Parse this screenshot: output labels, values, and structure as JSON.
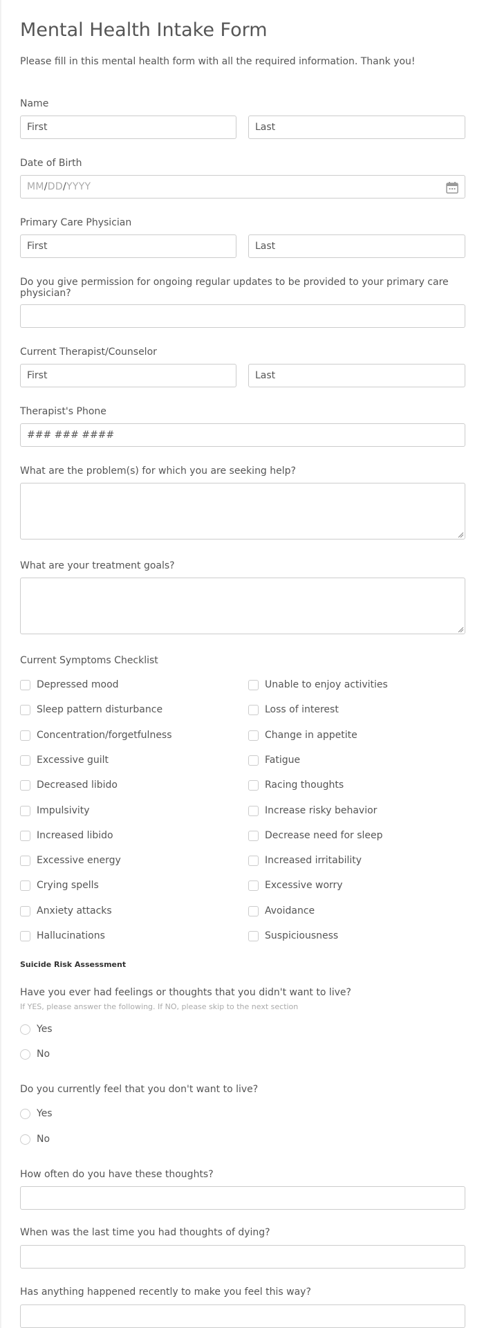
{
  "form": {
    "title": "Mental Health Intake Form",
    "subtitle": "Please fill in this mental health form with all the required information. Thank you!"
  },
  "fields": {
    "name": {
      "label": "Name",
      "first_placeholder": "First",
      "last_placeholder": "Last"
    },
    "dob": {
      "label": "Date of Birth",
      "mm": "MM",
      "dd": "DD",
      "yyyy": "YYYY",
      "sep": "/",
      "icon": "calendar-icon"
    },
    "pcp": {
      "label": "Primary Care Physician",
      "first_placeholder": "First",
      "last_placeholder": "Last"
    },
    "permission": {
      "label": "Do you give permission for ongoing regular updates to be provided to your primary care physician?",
      "value": ""
    },
    "therapist": {
      "label": "Current Therapist/Counselor",
      "first_placeholder": "First",
      "last_placeholder": "Last"
    },
    "phone": {
      "label": "Therapist's Phone",
      "placeholder": "### ### ####"
    },
    "problems": {
      "label": "What are the problem(s) for which you are seeking help?",
      "value": ""
    },
    "goals": {
      "label": "What are your treatment goals?",
      "value": ""
    }
  },
  "symptoms": {
    "label": "Current Symptoms Checklist",
    "left": [
      "Depressed mood",
      "Sleep pattern disturbance",
      "Concentration/forgetfulness",
      "Excessive guilt",
      "Decreased libido",
      "Impulsivity",
      "Increased libido",
      "Excessive energy",
      "Crying spells",
      "Anxiety attacks",
      "Hallucinations"
    ],
    "right": [
      "Unable to enjoy activities",
      "Loss of interest",
      "Change in appetite",
      "Fatigue",
      "Racing thoughts",
      "Increase risky behavior",
      "Decrease need for sleep",
      "Increased irritability",
      "Excessive worry",
      "Avoidance",
      "Suspiciousness"
    ]
  },
  "suicide": {
    "section_title": "Suicide Risk Assessment",
    "q1": {
      "label": "Have you ever had feelings or thoughts that you didn't want to live?",
      "hint": "If YES, please answer the following. If NO, please skip to the next section",
      "options": [
        "Yes",
        "No"
      ]
    },
    "q2": {
      "label": "Do you currently feel that you don't want to live?",
      "options": [
        "Yes",
        "No"
      ]
    },
    "how_often": {
      "label": "How often do you have these thoughts?",
      "value": ""
    },
    "last_time": {
      "label": "When was the last time you had thoughts of dying?",
      "value": ""
    },
    "recent": {
      "label": "Has anything happened recently to make you feel this way?",
      "value": ""
    }
  }
}
